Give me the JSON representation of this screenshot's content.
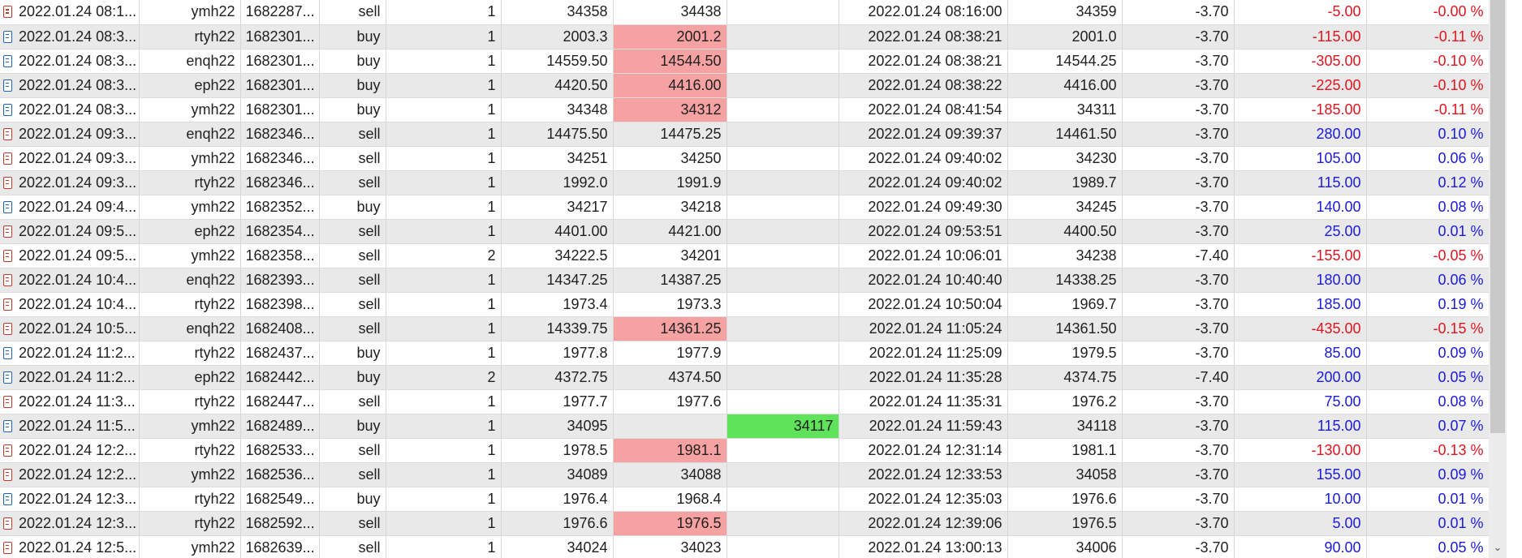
{
  "icons": {
    "sell": "sell-order-icon",
    "buy": "buy-order-icon",
    "scroll_down": "chevron-down-icon"
  },
  "colors": {
    "loss": "#e0141e",
    "profit": "#1a1adf",
    "sl_highlight": "#f7a2a2",
    "tp_highlight": "#5fe35a",
    "row_alt": "#e9e9e9"
  },
  "rows": [
    {
      "open_time": "2022.01.24 08:1...",
      "symbol": "ymh22",
      "ticket": "1682287...",
      "type": "sell",
      "volume": "1",
      "open_price": "34358",
      "sl": "34438",
      "tp": "",
      "close_time": "2022.01.24 08:16:00",
      "close_price": "34359",
      "commission": "-3.70",
      "profit": "-5.00",
      "change": "-0.00 %",
      "sign": "neg",
      "sl_hl": false,
      "tp_hl": false
    },
    {
      "open_time": "2022.01.24 08:3...",
      "symbol": "rtyh22",
      "ticket": "1682301...",
      "type": "buy",
      "volume": "1",
      "open_price": "2003.3",
      "sl": "2001.2",
      "tp": "",
      "close_time": "2022.01.24 08:38:21",
      "close_price": "2001.0",
      "commission": "-3.70",
      "profit": "-115.00",
      "change": "-0.11 %",
      "sign": "neg",
      "sl_hl": true,
      "tp_hl": false
    },
    {
      "open_time": "2022.01.24 08:3...",
      "symbol": "enqh22",
      "ticket": "1682301...",
      "type": "buy",
      "volume": "1",
      "open_price": "14559.50",
      "sl": "14544.50",
      "tp": "",
      "close_time": "2022.01.24 08:38:21",
      "close_price": "14544.25",
      "commission": "-3.70",
      "profit": "-305.00",
      "change": "-0.10 %",
      "sign": "neg",
      "sl_hl": true,
      "tp_hl": false
    },
    {
      "open_time": "2022.01.24 08:3...",
      "symbol": "eph22",
      "ticket": "1682301...",
      "type": "buy",
      "volume": "1",
      "open_price": "4420.50",
      "sl": "4416.00",
      "tp": "",
      "close_time": "2022.01.24 08:38:22",
      "close_price": "4416.00",
      "commission": "-3.70",
      "profit": "-225.00",
      "change": "-0.10 %",
      "sign": "neg",
      "sl_hl": true,
      "tp_hl": false
    },
    {
      "open_time": "2022.01.24 08:3...",
      "symbol": "ymh22",
      "ticket": "1682301...",
      "type": "buy",
      "volume": "1",
      "open_price": "34348",
      "sl": "34312",
      "tp": "",
      "close_time": "2022.01.24 08:41:54",
      "close_price": "34311",
      "commission": "-3.70",
      "profit": "-185.00",
      "change": "-0.11 %",
      "sign": "neg",
      "sl_hl": true,
      "tp_hl": false
    },
    {
      "open_time": "2022.01.24 09:3...",
      "symbol": "enqh22",
      "ticket": "1682346...",
      "type": "sell",
      "volume": "1",
      "open_price": "14475.50",
      "sl": "14475.25",
      "tp": "",
      "close_time": "2022.01.24 09:39:37",
      "close_price": "14461.50",
      "commission": "-3.70",
      "profit": "280.00",
      "change": "0.10 %",
      "sign": "pos",
      "sl_hl": false,
      "tp_hl": false
    },
    {
      "open_time": "2022.01.24 09:3...",
      "symbol": "ymh22",
      "ticket": "1682346...",
      "type": "sell",
      "volume": "1",
      "open_price": "34251",
      "sl": "34250",
      "tp": "",
      "close_time": "2022.01.24 09:40:02",
      "close_price": "34230",
      "commission": "-3.70",
      "profit": "105.00",
      "change": "0.06 %",
      "sign": "pos",
      "sl_hl": false,
      "tp_hl": false
    },
    {
      "open_time": "2022.01.24 09:3...",
      "symbol": "rtyh22",
      "ticket": "1682346...",
      "type": "sell",
      "volume": "1",
      "open_price": "1992.0",
      "sl": "1991.9",
      "tp": "",
      "close_time": "2022.01.24 09:40:02",
      "close_price": "1989.7",
      "commission": "-3.70",
      "profit": "115.00",
      "change": "0.12 %",
      "sign": "pos",
      "sl_hl": false,
      "tp_hl": false
    },
    {
      "open_time": "2022.01.24 09:4...",
      "symbol": "ymh22",
      "ticket": "1682352...",
      "type": "buy",
      "volume": "1",
      "open_price": "34217",
      "sl": "34218",
      "tp": "",
      "close_time": "2022.01.24 09:49:30",
      "close_price": "34245",
      "commission": "-3.70",
      "profit": "140.00",
      "change": "0.08 %",
      "sign": "pos",
      "sl_hl": false,
      "tp_hl": false
    },
    {
      "open_time": "2022.01.24 09:5...",
      "symbol": "eph22",
      "ticket": "1682354...",
      "type": "sell",
      "volume": "1",
      "open_price": "4401.00",
      "sl": "4421.00",
      "tp": "",
      "close_time": "2022.01.24 09:53:51",
      "close_price": "4400.50",
      "commission": "-3.70",
      "profit": "25.00",
      "change": "0.01 %",
      "sign": "pos",
      "sl_hl": false,
      "tp_hl": false
    },
    {
      "open_time": "2022.01.24 09:5...",
      "symbol": "ymh22",
      "ticket": "1682358...",
      "type": "sell",
      "volume": "2",
      "open_price": "34222.5",
      "sl": "34201",
      "tp": "",
      "close_time": "2022.01.24 10:06:01",
      "close_price": "34238",
      "commission": "-7.40",
      "profit": "-155.00",
      "change": "-0.05 %",
      "sign": "neg",
      "sl_hl": false,
      "tp_hl": false
    },
    {
      "open_time": "2022.01.24 10:4...",
      "symbol": "enqh22",
      "ticket": "1682393...",
      "type": "sell",
      "volume": "1",
      "open_price": "14347.25",
      "sl": "14387.25",
      "tp": "",
      "close_time": "2022.01.24 10:40:40",
      "close_price": "14338.25",
      "commission": "-3.70",
      "profit": "180.00",
      "change": "0.06 %",
      "sign": "pos",
      "sl_hl": false,
      "tp_hl": false
    },
    {
      "open_time": "2022.01.24 10:4...",
      "symbol": "rtyh22",
      "ticket": "1682398...",
      "type": "sell",
      "volume": "1",
      "open_price": "1973.4",
      "sl": "1973.3",
      "tp": "",
      "close_time": "2022.01.24 10:50:04",
      "close_price": "1969.7",
      "commission": "-3.70",
      "profit": "185.00",
      "change": "0.19 %",
      "sign": "pos",
      "sl_hl": false,
      "tp_hl": false
    },
    {
      "open_time": "2022.01.24 10:5...",
      "symbol": "enqh22",
      "ticket": "1682408...",
      "type": "sell",
      "volume": "1",
      "open_price": "14339.75",
      "sl": "14361.25",
      "tp": "",
      "close_time": "2022.01.24 11:05:24",
      "close_price": "14361.50",
      "commission": "-3.70",
      "profit": "-435.00",
      "change": "-0.15 %",
      "sign": "neg",
      "sl_hl": true,
      "tp_hl": false
    },
    {
      "open_time": "2022.01.24 11:2...",
      "symbol": "rtyh22",
      "ticket": "1682437...",
      "type": "buy",
      "volume": "1",
      "open_price": "1977.8",
      "sl": "1977.9",
      "tp": "",
      "close_time": "2022.01.24 11:25:09",
      "close_price": "1979.5",
      "commission": "-3.70",
      "profit": "85.00",
      "change": "0.09 %",
      "sign": "pos",
      "sl_hl": false,
      "tp_hl": false
    },
    {
      "open_time": "2022.01.24 11:2...",
      "symbol": "eph22",
      "ticket": "1682442...",
      "type": "buy",
      "volume": "2",
      "open_price": "4372.75",
      "sl": "4374.50",
      "tp": "",
      "close_time": "2022.01.24 11:35:28",
      "close_price": "4374.75",
      "commission": "-7.40",
      "profit": "200.00",
      "change": "0.05 %",
      "sign": "pos",
      "sl_hl": false,
      "tp_hl": false
    },
    {
      "open_time": "2022.01.24 11:3...",
      "symbol": "rtyh22",
      "ticket": "1682447...",
      "type": "sell",
      "volume": "1",
      "open_price": "1977.7",
      "sl": "1977.6",
      "tp": "",
      "close_time": "2022.01.24 11:35:31",
      "close_price": "1976.2",
      "commission": "-3.70",
      "profit": "75.00",
      "change": "0.08 %",
      "sign": "pos",
      "sl_hl": false,
      "tp_hl": false
    },
    {
      "open_time": "2022.01.24 11:5...",
      "symbol": "ymh22",
      "ticket": "1682489...",
      "type": "buy",
      "volume": "1",
      "open_price": "34095",
      "sl": "",
      "tp": "34117",
      "close_time": "2022.01.24 11:59:43",
      "close_price": "34118",
      "commission": "-3.70",
      "profit": "115.00",
      "change": "0.07 %",
      "sign": "pos",
      "sl_hl": false,
      "tp_hl": true
    },
    {
      "open_time": "2022.01.24 12:2...",
      "symbol": "rtyh22",
      "ticket": "1682533...",
      "type": "sell",
      "volume": "1",
      "open_price": "1978.5",
      "sl": "1981.1",
      "tp": "",
      "close_time": "2022.01.24 12:31:14",
      "close_price": "1981.1",
      "commission": "-3.70",
      "profit": "-130.00",
      "change": "-0.13 %",
      "sign": "neg",
      "sl_hl": true,
      "tp_hl": false
    },
    {
      "open_time": "2022.01.24 12:2...",
      "symbol": "ymh22",
      "ticket": "1682536...",
      "type": "sell",
      "volume": "1",
      "open_price": "34089",
      "sl": "34088",
      "tp": "",
      "close_time": "2022.01.24 12:33:53",
      "close_price": "34058",
      "commission": "-3.70",
      "profit": "155.00",
      "change": "0.09 %",
      "sign": "pos",
      "sl_hl": false,
      "tp_hl": false
    },
    {
      "open_time": "2022.01.24 12:3...",
      "symbol": "rtyh22",
      "ticket": "1682549...",
      "type": "buy",
      "volume": "1",
      "open_price": "1976.4",
      "sl": "1968.4",
      "tp": "",
      "close_time": "2022.01.24 12:35:03",
      "close_price": "1976.6",
      "commission": "-3.70",
      "profit": "10.00",
      "change": "0.01 %",
      "sign": "pos",
      "sl_hl": false,
      "tp_hl": false
    },
    {
      "open_time": "2022.01.24 12:3...",
      "symbol": "rtyh22",
      "ticket": "1682592...",
      "type": "sell",
      "volume": "1",
      "open_price": "1976.6",
      "sl": "1976.5",
      "tp": "",
      "close_time": "2022.01.24 12:39:06",
      "close_price": "1976.5",
      "commission": "-3.70",
      "profit": "5.00",
      "change": "0.01 %",
      "sign": "pos",
      "sl_hl": true,
      "tp_hl": false
    },
    {
      "open_time": "2022.01.24 12:5...",
      "symbol": "ymh22",
      "ticket": "1682639...",
      "type": "sell",
      "volume": "1",
      "open_price": "34024",
      "sl": "34023",
      "tp": "",
      "close_time": "2022.01.24 13:00:13",
      "close_price": "34006",
      "commission": "-3.70",
      "profit": "90.00",
      "change": "0.05 %",
      "sign": "pos",
      "sl_hl": false,
      "tp_hl": false
    }
  ]
}
